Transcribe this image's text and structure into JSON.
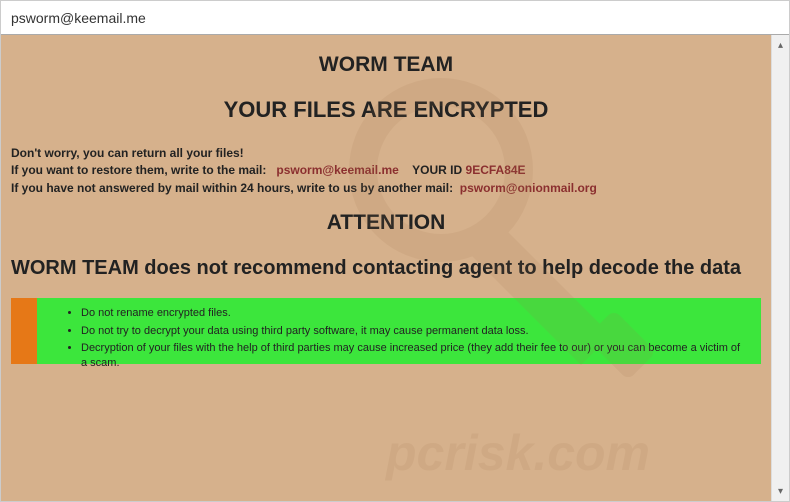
{
  "titlebar": {
    "text": "psworm@keemail.me"
  },
  "headings": {
    "team": "WORM TEAM",
    "encrypted": "YOUR FILES ARE ENCRYPTED",
    "attention": "ATTENTION",
    "no_agent": "WORM TEAM does not recommend contacting agent to help decode the data"
  },
  "instructions": {
    "line1": "Don't worry, you can return all your files!",
    "line2_prefix": "If you want to restore them, write to the mail:",
    "email1": "psworm@keemail.me",
    "id_label": "YOUR ID",
    "id_value": "9ECFA84E",
    "line3_prefix": "If you have not answered by mail within 24 hours, write to us by another mail:",
    "email2": "psworm@onionmail.org"
  },
  "warnings": {
    "items": [
      "Do not rename encrypted files.",
      "Do not try to decrypt your data using third party software, it may cause permanent data loss.",
      "Decryption of your files with the help of third parties may cause increased price (they add their fee to our) or you can become a victim of a scam."
    ]
  },
  "watermark": {
    "url_text": "pcrisk.com"
  }
}
